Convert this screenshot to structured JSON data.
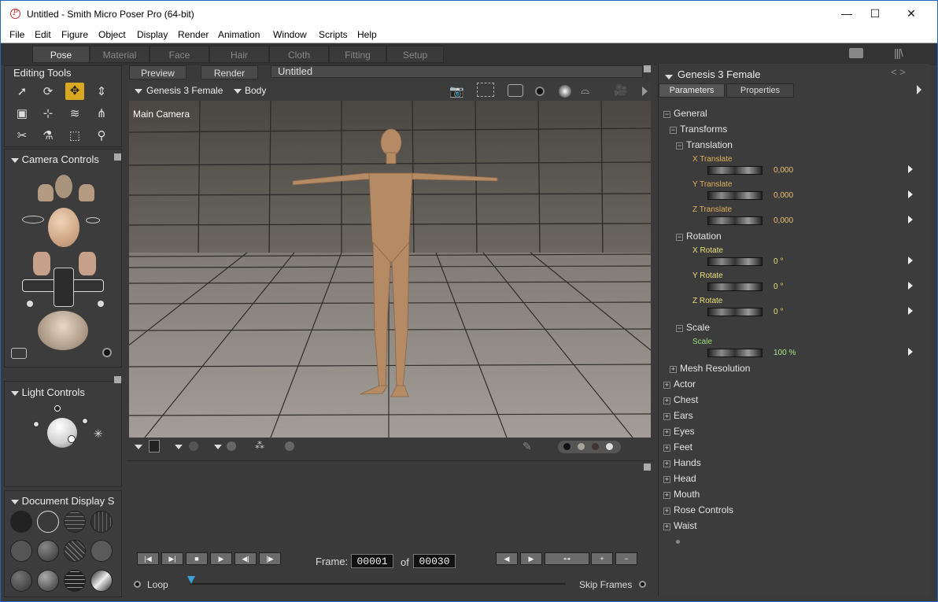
{
  "window": {
    "title": "Untitled - Smith Micro Poser Pro  (64-bit)",
    "minimize": "—",
    "maximize": "☐",
    "close": "✕",
    "app_icon": "poser-app-icon"
  },
  "menu": [
    "File",
    "Edit",
    "Figure",
    "Object",
    "Display",
    "Render",
    "Animation",
    "Window",
    "Scripts",
    "Help"
  ],
  "rooms": [
    "Pose",
    "Material",
    "Face",
    "Hair",
    "Cloth",
    "Fitting",
    "Setup"
  ],
  "active_room": "Pose",
  "editing_tools": {
    "title": "Editing Tools"
  },
  "camera_controls": {
    "title": "Camera Controls"
  },
  "light_controls": {
    "title": "Light Controls"
  },
  "document_display": {
    "title": "Document Display S"
  },
  "viewport": {
    "tabs": [
      "Preview",
      "Render"
    ],
    "doc_title": "Untitled",
    "figure": "Genesis 3 Female",
    "body_part": "Body",
    "camera_label": "Main Camera"
  },
  "parameters": {
    "figure": "Genesis 3 Female",
    "tabs": [
      "Parameters",
      "Properties"
    ],
    "general": "General",
    "transforms": "Transforms",
    "translation": "Translation",
    "rotation": "Rotation",
    "scale_group": "Scale",
    "x_translate": {
      "name": "X Translate",
      "value": "0,000"
    },
    "y_translate": {
      "name": "Y Translate",
      "value": "0,000"
    },
    "z_translate": {
      "name": "Z Translate",
      "value": "0,000"
    },
    "x_rotate": {
      "name": "X Rotate",
      "value": "0 °"
    },
    "y_rotate": {
      "name": "Y Rotate",
      "value": "0 °"
    },
    "z_rotate": {
      "name": "Z Rotate",
      "value": "0 °"
    },
    "scale": {
      "name": "Scale",
      "value": "100 %"
    },
    "mesh_resolution": "Mesh Resolution",
    "groups": [
      "Actor",
      "Chest",
      "Ears",
      "Eyes",
      "Feet",
      "Hands",
      "Head",
      "Mouth",
      "Rose Controls",
      "Waist"
    ]
  },
  "animation": {
    "frame_label": "Frame:",
    "current_frame": "00001",
    "of_label": "of",
    "total_frames": "00030",
    "loop": "Loop",
    "skip_frames": "Skip Frames"
  }
}
